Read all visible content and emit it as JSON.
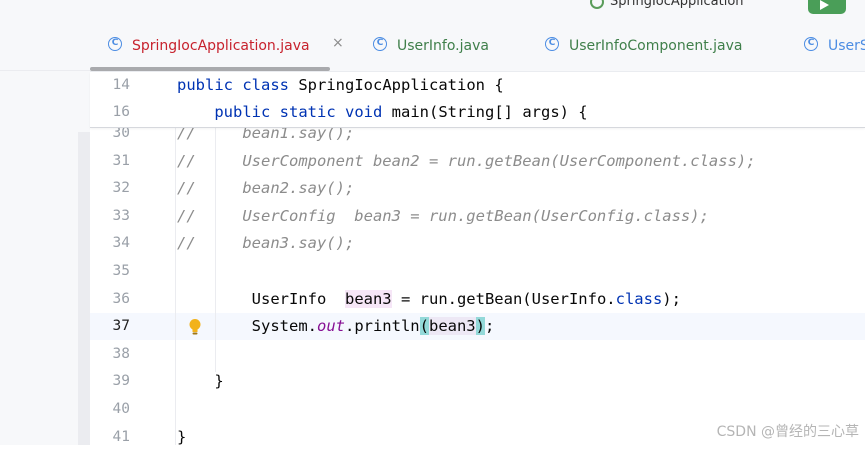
{
  "toolbar": {
    "run_config_text": "SpringIocApplication"
  },
  "tabs": [
    {
      "label": "SpringIocApplication.java",
      "active": true
    },
    {
      "label": "UserInfo.java",
      "active": false
    },
    {
      "label": "UserInfoComponent.java",
      "active": false
    },
    {
      "label": "UserS",
      "active": false
    }
  ],
  "tab_close_symbol": "×",
  "sticky_lines": [
    {
      "num": "14",
      "parts": [
        {
          "t": "kw",
          "v": "public"
        },
        {
          "t": "",
          "v": " "
        },
        {
          "t": "kw",
          "v": "class"
        },
        {
          "t": "",
          "v": " SpringIocApplication {"
        }
      ]
    },
    {
      "num": "16",
      "parts": [
        {
          "t": "",
          "v": "    "
        },
        {
          "t": "kw",
          "v": "public"
        },
        {
          "t": "",
          "v": " "
        },
        {
          "t": "kw",
          "v": "static"
        },
        {
          "t": "",
          "v": " "
        },
        {
          "t": "kw",
          "v": "void"
        },
        {
          "t": "",
          "v": " main(String[] args) {"
        }
      ]
    }
  ],
  "lines": [
    {
      "num": "30",
      "parts": [
        {
          "t": "cm",
          "v": "//     bean1.say();"
        }
      ]
    },
    {
      "num": "31",
      "parts": [
        {
          "t": "cm",
          "v": "//     UserComponent bean2 = run.getBean(UserComponent.class);"
        }
      ]
    },
    {
      "num": "32",
      "parts": [
        {
          "t": "cm",
          "v": "//     bean2.say();"
        }
      ]
    },
    {
      "num": "33",
      "parts": [
        {
          "t": "cm",
          "v": "//     UserConfig  bean3 = run.getBean(UserConfig.class);"
        }
      ]
    },
    {
      "num": "34",
      "parts": [
        {
          "t": "cm",
          "v": "//     bean3.say();"
        }
      ]
    },
    {
      "num": "35",
      "parts": []
    },
    {
      "num": "36",
      "parts": [
        {
          "t": "",
          "v": "        UserInfo  "
        },
        {
          "t": "hl-var",
          "v": "bean3"
        },
        {
          "t": "",
          "v": " = run.getBean(UserInfo."
        },
        {
          "t": "kw",
          "v": "class"
        },
        {
          "t": "",
          "v": ");"
        }
      ]
    },
    {
      "num": "37",
      "current": true,
      "bulb": true,
      "parts": [
        {
          "t": "",
          "v": "        System."
        },
        {
          "t": "st",
          "v": "out"
        },
        {
          "t": "",
          "v": ".println"
        },
        {
          "t": "hl-paren",
          "v": "("
        },
        {
          "t": "hl-arg",
          "v": "bean3"
        },
        {
          "t": "hl-paren",
          "v": ")"
        },
        {
          "t": "",
          "v": ";"
        }
      ]
    },
    {
      "num": "38",
      "parts": []
    },
    {
      "num": "39",
      "parts": [
        {
          "t": "",
          "v": "    }"
        }
      ]
    },
    {
      "num": "40",
      "parts": []
    },
    {
      "num": "41",
      "parts": [
        {
          "t": "",
          "v": "}"
        }
      ]
    }
  ],
  "watermark": "CSDN @曾经的三心草",
  "colors": {
    "keyword": "#0033b3",
    "comment": "#8c8c8c",
    "static_field": "#871094",
    "active_tab": "#c7222d",
    "run_button": "#4a9e58"
  }
}
